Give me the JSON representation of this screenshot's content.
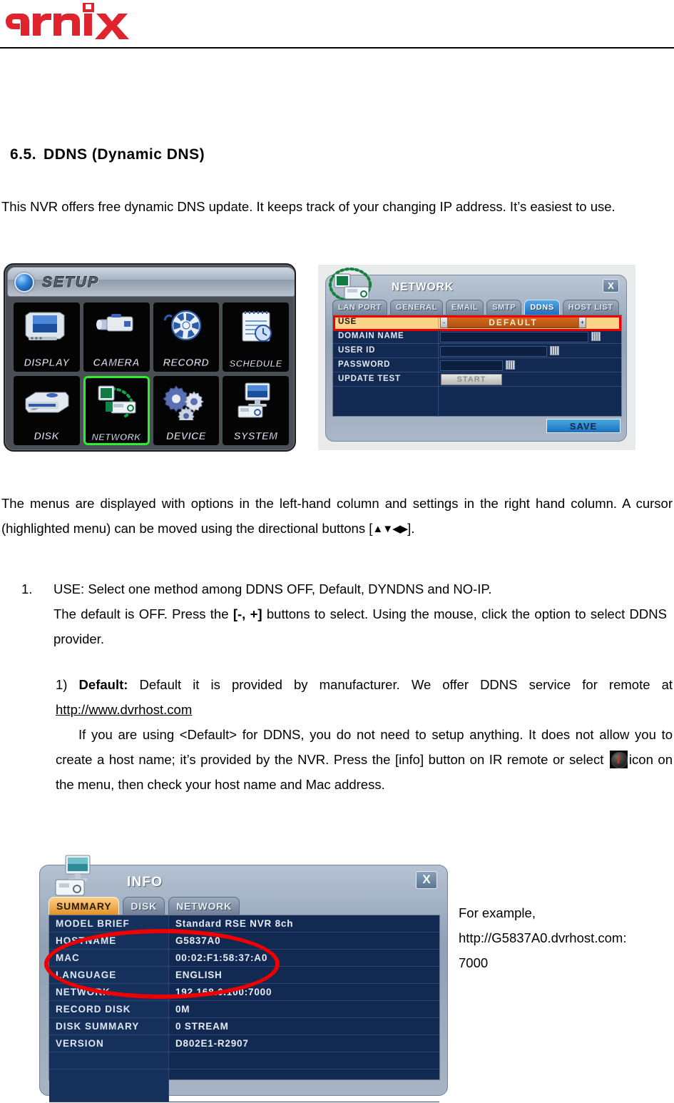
{
  "header": {
    "logo_text": "arnix"
  },
  "heading": {
    "number": "6.5.",
    "title": "DDNS  (Dynamic  DNS)"
  },
  "intro_paragraph": "This NVR offers free dynamic DNS update. It keeps track of your changing IP address.    It’s easiest to use.",
  "mid_paragraph_before": "The menus are displayed with options in the left-hand column and settings in the right hand column.    A cursor (highlighted menu) can be moved using the directional buttons [",
  "mid_paragraph_arrows": "▲▼◀▶",
  "mid_paragraph_after": "].",
  "list": {
    "marker": "1.",
    "line1": "USE: Select one method among DDNS OFF, Default, DYNDNS and NO-IP.",
    "line2_a": "The default is OFF. Press the ",
    "line2_b": "[-, +]",
    "line2_c": " buttons to select. Using the mouse, click the option to select DDNS provider."
  },
  "default_section": {
    "item_number": "1)",
    "label": "Default:",
    "text_a": " Default it is provided by manufacturer. We offer DDNS service for remote at ",
    "url": "http://www.dvrhost.com",
    "text_b": "If you are using <Default> for DDNS, you do not need to setup anything. It does not allow you to create a host name; it’s provided by the NVR. Press the [info] button on IR remote or select ",
    "icon_name": "info-icon",
    "text_c": "icon on the menu, then check your host name and Mac address."
  },
  "example": {
    "line1": "For example,",
    "line2": "http://G5837A0.dvrhost.com:",
    "line3": "7000"
  },
  "setup_panel": {
    "title": "SETUP",
    "tiles": [
      {
        "label": "DISPLAY",
        "icon": "monitor-icon",
        "selected": false
      },
      {
        "label": "CAMERA",
        "icon": "camera-icon",
        "selected": false
      },
      {
        "label": "RECORD",
        "icon": "reel-icon",
        "selected": false
      },
      {
        "label": "SCHEDULE",
        "icon": "calendar-clock-icon",
        "selected": false
      },
      {
        "label": "DISK",
        "icon": "harddisk-icon",
        "selected": false
      },
      {
        "label": "NETWORK",
        "icon": "network-icon",
        "selected": true
      },
      {
        "label": "DEVICE",
        "icon": "gears-icon",
        "selected": false
      },
      {
        "label": "SYSTEM",
        "icon": "computer-icon",
        "selected": false
      }
    ],
    "selected_tile": "NETWORK",
    "highlight_color": "#2bf02b"
  },
  "network_dialog": {
    "title": "NETWORK",
    "close_label": "X",
    "tabs": [
      {
        "label": "LAN PORT",
        "active": false
      },
      {
        "label": "GENERAL",
        "active": false
      },
      {
        "label": "EMAIL",
        "active": false
      },
      {
        "label": "SMTP",
        "active": false
      },
      {
        "label": "DDNS",
        "active": true
      },
      {
        "label": "HOST LIST",
        "active": false
      }
    ],
    "active_tab": "DDNS",
    "rows": [
      {
        "label": "USE",
        "value": "DEFAULT",
        "type": "select",
        "highlighted": true
      },
      {
        "label": "DOMAIN NAME",
        "value": "",
        "type": "text-wide",
        "highlighted": false
      },
      {
        "label": "USER ID",
        "value": "",
        "type": "text-mid",
        "highlighted": false
      },
      {
        "label": "PASSWORD",
        "value": "",
        "type": "text-narrow",
        "highlighted": false
      },
      {
        "label": "UPDATE TEST",
        "value": "START",
        "type": "button",
        "highlighted": false
      }
    ],
    "spinner_minus": "-",
    "spinner_plus": "+",
    "save_label": "SAVE",
    "annotation_color": "#ee0000"
  },
  "info_dialog": {
    "title": "INFO",
    "close_label": "X",
    "tabs": [
      {
        "label": "SUMMARY",
        "active": true
      },
      {
        "label": "DISK",
        "active": false
      },
      {
        "label": "NETWORK",
        "active": false
      }
    ],
    "active_tab": "SUMMARY",
    "rows": [
      {
        "label": "MODEL BRIEF",
        "value": "Standard RSE NVR 8ch"
      },
      {
        "label": "HOSTNAME",
        "value": "G5837A0"
      },
      {
        "label": "MAC",
        "value": "00:02:F1:58:37:A0"
      },
      {
        "label": "LANGUAGE",
        "value": "ENGLISH"
      },
      {
        "label": "NETWORK",
        "value": "192.168.6.100:7000"
      },
      {
        "label": "RECORD DISK",
        "value": "0M"
      },
      {
        "label": "DISK SUMMARY",
        "value": "0 STREAM"
      },
      {
        "label": "VERSION",
        "value": "D802E1-R2907"
      },
      {
        "label": "",
        "value": ""
      },
      {
        "label": "",
        "value": ""
      }
    ],
    "annotation_color": "#ee0000"
  }
}
